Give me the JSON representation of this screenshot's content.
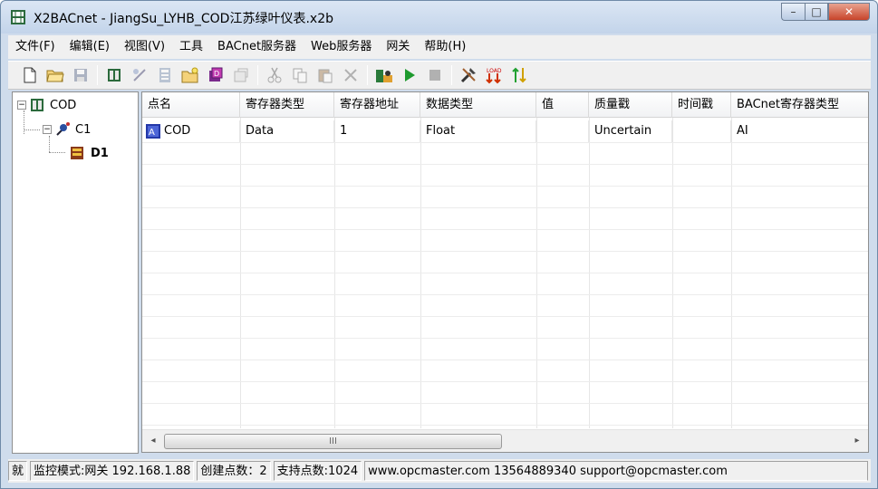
{
  "window": {
    "title": "X2BACnet - JiangSu_LYHB_COD江苏绿叶仪表.x2b",
    "app_icon": "bacnet-app-icon",
    "caption": {
      "minimize": "–",
      "maximize": "□",
      "close": "✕"
    }
  },
  "menu": [
    {
      "label": "文件(F)"
    },
    {
      "label": "编辑(E)"
    },
    {
      "label": "视图(V)"
    },
    {
      "label": "工具"
    },
    {
      "label": "BACnet服务器"
    },
    {
      "label": "Web服务器"
    },
    {
      "label": "网关"
    },
    {
      "label": "帮助(H)"
    }
  ],
  "toolbar": {
    "icons": [
      "new-file-icon",
      "open-folder-icon",
      "save-icon",
      "add-device-icon",
      "add-channel-icon",
      "add-group-icon",
      "add-item-icon",
      "add-point-icon",
      "properties-icon",
      "cut-icon",
      "copy-icon",
      "paste-icon",
      "delete-icon",
      "monitor-icon",
      "run-icon",
      "stop-icon",
      "tools-icon",
      "load-icon",
      "transfer-icon"
    ]
  },
  "tree": {
    "root": {
      "label": "COD",
      "expander": "−"
    },
    "channel": {
      "label": "C1",
      "expander": "−"
    },
    "device": {
      "label": "D1"
    }
  },
  "table": {
    "columns": [
      "点名",
      "寄存器类型",
      "寄存器地址",
      "数据类型",
      "值",
      "质量戳",
      "时间戳",
      "BACnet寄存器类型"
    ],
    "rows": [
      [
        "COD",
        "Data",
        "1",
        "Float",
        "",
        "Uncertain",
        "",
        "AI"
      ]
    ],
    "scroll": {
      "left": "◂",
      "right": "▸",
      "grip": "III"
    }
  },
  "status": {
    "ready": "就",
    "mode": "监控模式:网关 192.168.1.88",
    "created": "创建点数：2",
    "supported": "支持点数:1024",
    "contact": "www.opcmaster.com 13564889340 support@opcmaster.com"
  }
}
